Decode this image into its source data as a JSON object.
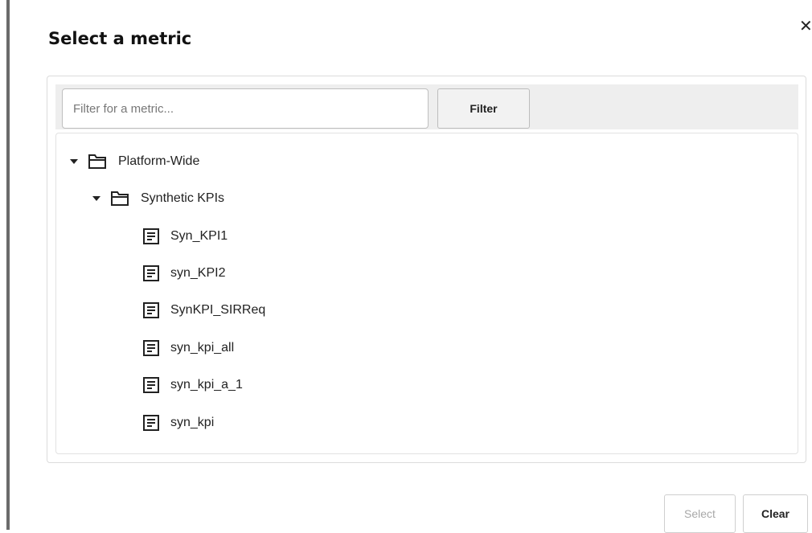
{
  "dialog": {
    "title": "Select a metric",
    "close_icon": "close-icon"
  },
  "filter": {
    "placeholder": "Filter for a metric...",
    "value": "",
    "button_label": "Filter"
  },
  "tree": {
    "root": {
      "label": "Platform-Wide",
      "expanded": true,
      "icon": "folder-icon",
      "child": {
        "label": "Synthetic KPIs",
        "expanded": true,
        "icon": "folder-icon",
        "items": [
          {
            "label": "Syn_KPI1",
            "icon": "metric-doc-icon"
          },
          {
            "label": "syn_KPI2",
            "icon": "metric-doc-icon"
          },
          {
            "label": "SynKPI_SIRReq",
            "icon": "metric-doc-icon"
          },
          {
            "label": "syn_kpi_all",
            "icon": "metric-doc-icon"
          },
          {
            "label": "syn_kpi_a_1",
            "icon": "metric-doc-icon"
          },
          {
            "label": "syn_kpi",
            "icon": "metric-doc-icon"
          }
        ]
      }
    }
  },
  "footer": {
    "select_label": "Select",
    "select_disabled": true,
    "clear_label": "Clear"
  },
  "colors": {
    "filter_bar_bg": "#eeeeee",
    "disabled_text": "#a8a8a8",
    "left_edge": "#6b6b6b"
  }
}
